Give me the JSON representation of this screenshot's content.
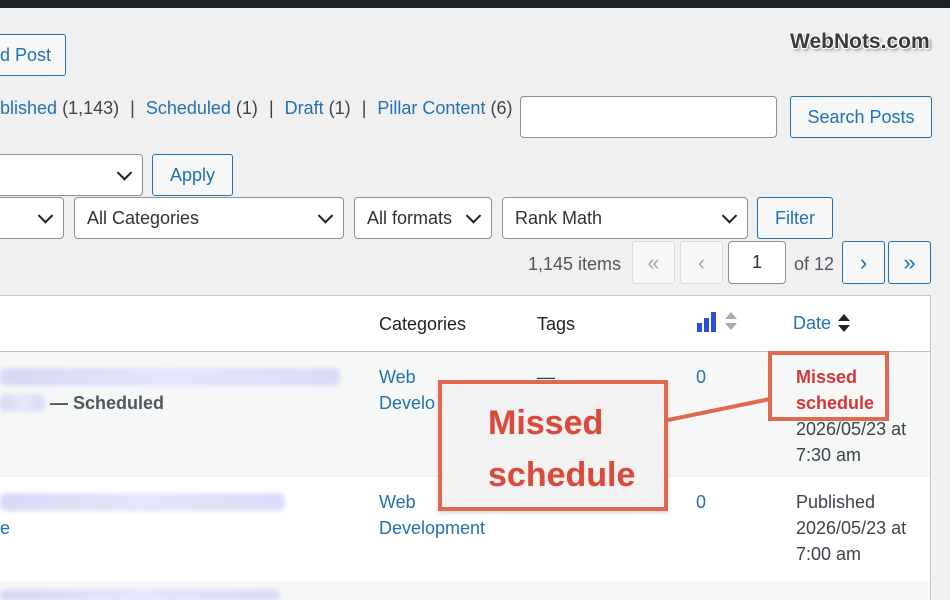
{
  "header": {
    "add_post_label": "d Post",
    "watermark": "WebNots.com"
  },
  "filters_links": {
    "published_label": "blished",
    "published_count": "(1,143)",
    "scheduled_label": "Scheduled",
    "scheduled_count": "(1)",
    "draft_label": "Draft",
    "draft_count": "(1)",
    "pillar_label": "Pillar Content",
    "pillar_count": "(6)",
    "separator": "|"
  },
  "search": {
    "value": "",
    "button_label": "Search Posts"
  },
  "bulk": {
    "apply_label": "Apply"
  },
  "filter_bar": {
    "categories": "All Categories",
    "formats": "All formats",
    "seo": "Rank Math",
    "filter_label": "Filter"
  },
  "pagination": {
    "items": "1,145 items",
    "first": "«",
    "prev": "‹",
    "current_page": "1",
    "of_pages": "of 12",
    "next": "›",
    "last": "»"
  },
  "table": {
    "headers": {
      "categories": "Categories",
      "tags": "Tags",
      "date": "Date"
    },
    "rows": [
      {
        "title_suffix": "— Scheduled",
        "category_line1": "Web",
        "category_line2": "Develo",
        "tags": "—",
        "seo_count": "0",
        "status_line1": "Missed",
        "status_line2": "schedule",
        "date_line1": "2026/05/23 at",
        "date_line2": "7:30 am"
      },
      {
        "title_suffix": "e",
        "category_line1": "Web",
        "category_line2": "Development",
        "tags": "",
        "seo_count": "0",
        "status_line1": "Published",
        "date_line1": "2026/05/23 at",
        "date_line2": "7:00 am"
      }
    ]
  },
  "callout": {
    "line1": "Missed",
    "line2": "schedule"
  },
  "colors": {
    "link": "#2271b1",
    "highlight": "#e06952",
    "missed_text": "#d63638"
  }
}
